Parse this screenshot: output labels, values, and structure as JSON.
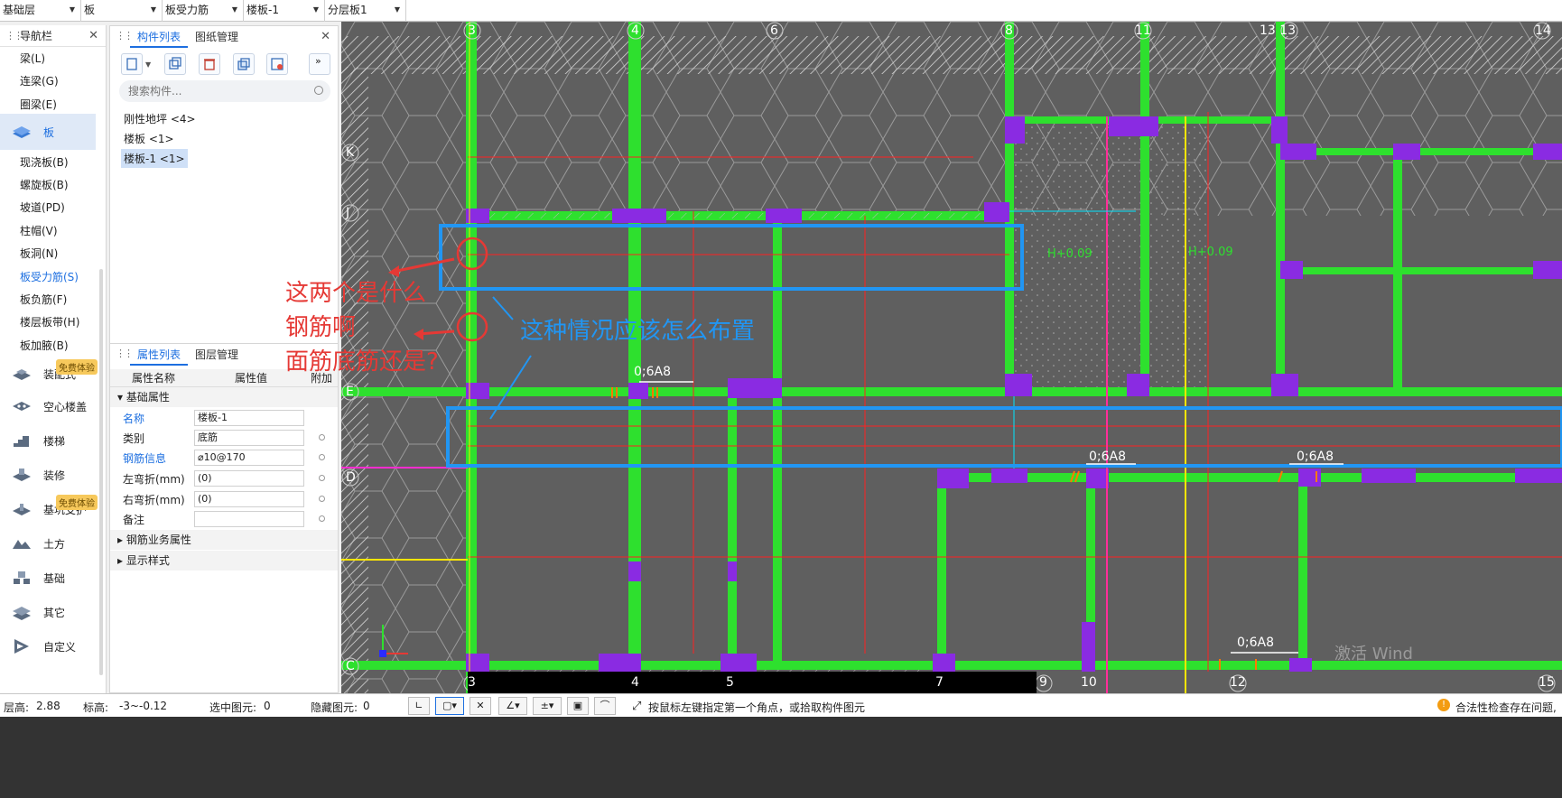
{
  "combos": [
    {
      "label": "基础层"
    },
    {
      "label": "板"
    },
    {
      "label": "板受力筋"
    },
    {
      "label": "楼板-1"
    },
    {
      "label": "分层板1"
    }
  ],
  "nav": {
    "title": "导航栏",
    "items_top": [
      "梁(L)",
      "连梁(G)",
      "圈梁(E)"
    ],
    "selected_category": "板",
    "items_board": [
      "现浇板(B)",
      "螺旋板(B)",
      "坡道(PD)",
      "柱帽(V)",
      "板洞(N)",
      "板受力筋(S)",
      "板负筋(F)",
      "楼层板带(H)",
      "板加腋(B)"
    ],
    "categories": [
      "装配式",
      "空心楼盖",
      "楼梯",
      "装修",
      "基坑支护",
      "土方",
      "基础",
      "其它",
      "自定义"
    ],
    "badge": "免费体验"
  },
  "complist": {
    "tabs": [
      "构件列表",
      "图纸管理"
    ],
    "search_placeholder": "搜索构件...",
    "items": [
      "刚性地坪 <4>",
      "楼板 <1>",
      "楼板-1 <1>"
    ]
  },
  "props": {
    "tabs": [
      "属性列表",
      "图层管理"
    ],
    "headers": [
      "属性名称",
      "属性值",
      "附加"
    ],
    "group_basic": "基础属性",
    "rows": [
      {
        "name": "名称",
        "value": "楼板-1"
      },
      {
        "name": "类别",
        "value": "底筋"
      },
      {
        "name": "钢筋信息",
        "value": "⌀10@170"
      },
      {
        "name": "左弯折(mm)",
        "value": "(0)"
      },
      {
        "name": "右弯折(mm)",
        "value": "(0)"
      },
      {
        "name": "备注",
        "value": ""
      }
    ],
    "group_rebar": "钢筋业务属性",
    "group_display": "显示样式"
  },
  "canvas": {
    "axis_top": [
      "3",
      "4",
      "6",
      "8",
      "11",
      "13 13",
      "14"
    ],
    "axis_bottom": [
      "3",
      "4",
      "5",
      "7",
      "9",
      "10",
      "12",
      "15"
    ],
    "axis_left": [
      "K",
      "J",
      "E",
      "D",
      "C"
    ],
    "rebar_labels": [
      "0;6A8",
      "0;6A8",
      "0;6A8",
      "0;6A8"
    ],
    "height_labels": [
      "H+0.09",
      "H+0.09"
    ],
    "annotation_q1": "这两个是什么",
    "annotation_q2": "钢筋啊",
    "annotation_q3": "面筋底筋还是?",
    "annotation_q4": "这种情况应该怎么布置",
    "watermark": "激活 Wind"
  },
  "status": {
    "floor_height_label": "层高:",
    "floor_height": "2.88",
    "elevation_label": "标高:",
    "elevation": "-3~-0.12",
    "selected_label": "选中图元:",
    "selected": "0",
    "hidden_label": "隐藏图元:",
    "hidden": "0",
    "hint": "按鼠标左键指定第一个角点，或拾取构件图元",
    "check": "合法性检查存在问题,"
  },
  "colors": {
    "accent": "#1d6fe0",
    "wall_green": "#2ee02e",
    "column_purple": "#8a2be2",
    "annotation_red": "#e53935",
    "annotation_blue": "#2196f3"
  }
}
